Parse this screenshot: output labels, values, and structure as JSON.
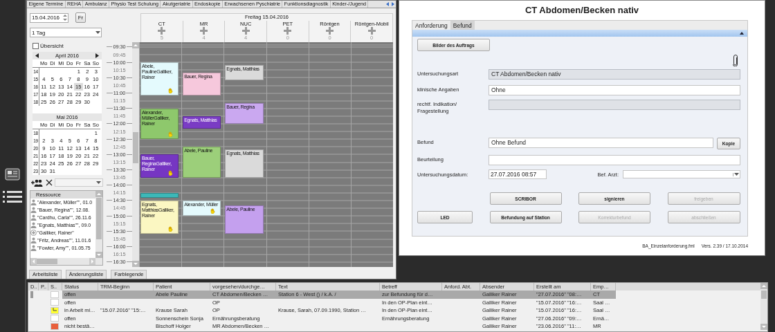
{
  "planner": {
    "tabs": [
      {
        "label": "Eigene Termine",
        "selected": false
      },
      {
        "label": "REHA",
        "selected": false
      },
      {
        "label": "Ambulanz",
        "selected": false
      },
      {
        "label": "Physio Test Schulung",
        "selected": false
      },
      {
        "label": "Akutgeriatrie",
        "selected": false
      },
      {
        "label": "Endoskopie",
        "selected": false
      },
      {
        "label": "Erwachsenen Pyschiatrie",
        "selected": false
      },
      {
        "label": "Funktionsdiagnostik",
        "selected": false
      },
      {
        "label": "Kinder-/Jugend",
        "selected": false
      }
    ],
    "date_field": {
      "value": "15.04.2016"
    },
    "day_button": "Fr",
    "range_dropdown": {
      "value": "1 Tag"
    },
    "overview_checkbox": {
      "label": "Übersicht",
      "checked": false
    },
    "calendars": [
      {
        "title": "April 2016",
        "nav": true,
        "weekdays": [
          "Mo",
          "Di",
          "Mi",
          "Do",
          "Fr",
          "Sa",
          "So"
        ],
        "weeks": [
          {
            "number": "14",
            "days": [
              {
                "label": "1",
                "selected": false
              },
              {
                "label": "2",
                "selected": false
              },
              {
                "label": "3",
                "selected": false
              }
            ]
          },
          {
            "number": "15",
            "days": [
              {
                "label": "4",
                "selected": false
              },
              {
                "label": "5",
                "selected": false
              },
              {
                "label": "6",
                "selected": false
              },
              {
                "label": "7",
                "selected": false
              },
              {
                "label": "8",
                "selected": false
              },
              {
                "label": "9",
                "selected": false
              },
              {
                "label": "10",
                "selected": false
              }
            ]
          },
          {
            "number": "16",
            "days": [
              {
                "label": "11",
                "selected": false
              },
              {
                "label": "12",
                "selected": false
              },
              {
                "label": "13",
                "selected": false
              },
              {
                "label": "14",
                "selected": false
              },
              {
                "label": "15",
                "selected": true
              },
              {
                "label": "16",
                "selected": false
              },
              {
                "label": "17",
                "selected": false
              }
            ]
          },
          {
            "number": "17",
            "days": [
              {
                "label": "18",
                "selected": false
              },
              {
                "label": "19",
                "selected": false
              },
              {
                "label": "20",
                "selected": false
              },
              {
                "label": "21",
                "selected": false
              },
              {
                "label": "22",
                "selected": false
              },
              {
                "label": "23",
                "selected": false
              },
              {
                "label": "24",
                "selected": false
              }
            ]
          },
          {
            "number": "18",
            "days": [
              {
                "label": "25",
                "selected": false
              },
              {
                "label": "26",
                "selected": false
              },
              {
                "label": "27",
                "selected": false
              },
              {
                "label": "28",
                "selected": false
              },
              {
                "label": "29",
                "selected": false
              },
              {
                "label": "30",
                "selected": false
              }
            ]
          }
        ]
      },
      {
        "title": "Mai 2016",
        "nav": false,
        "weekdays": [
          "Mo",
          "Di",
          "Mi",
          "Do",
          "Fr",
          "Sa",
          "So"
        ],
        "weeks": [
          {
            "number": "18",
            "days": [
              {
                "label": "1",
                "selected": false
              }
            ]
          },
          {
            "number": "19",
            "days": [
              {
                "label": "2",
                "selected": false
              },
              {
                "label": "3",
                "selected": false
              },
              {
                "label": "4",
                "selected": false
              },
              {
                "label": "5",
                "selected": false
              },
              {
                "label": "6",
                "selected": false
              },
              {
                "label": "7",
                "selected": false
              },
              {
                "label": "8",
                "selected": false
              }
            ]
          },
          {
            "number": "20",
            "days": [
              {
                "label": "9",
                "selected": false
              },
              {
                "label": "10",
                "selected": false
              },
              {
                "label": "11",
                "selected": false
              },
              {
                "label": "12",
                "selected": false
              },
              {
                "label": "13",
                "selected": false
              },
              {
                "label": "14",
                "selected": false
              },
              {
                "label": "15",
                "selected": false
              }
            ]
          },
          {
            "number": "21",
            "days": [
              {
                "label": "16",
                "selected": false
              },
              {
                "label": "17",
                "selected": false
              },
              {
                "label": "18",
                "selected": false
              },
              {
                "label": "19",
                "selected": false
              },
              {
                "label": "20",
                "selected": false
              },
              {
                "label": "21",
                "selected": false
              },
              {
                "label": "22",
                "selected": false
              }
            ]
          },
          {
            "number": "22",
            "days": [
              {
                "label": "23",
                "selected": false
              },
              {
                "label": "24",
                "selected": false
              },
              {
                "label": "25",
                "selected": false
              },
              {
                "label": "26",
                "selected": false
              },
              {
                "label": "27",
                "selected": false
              },
              {
                "label": "28",
                "selected": false
              },
              {
                "label": "29",
                "selected": false
              }
            ]
          },
          {
            "number": "23",
            "days": [
              {
                "label": "30",
                "selected": false
              },
              {
                "label": "31",
                "selected": false
              }
            ]
          }
        ]
      }
    ],
    "resources": {
      "header": "Ressource",
      "items": [
        {
          "label": "\"Alexander, Müller\"\", 01.0",
          "kind": "person"
        },
        {
          "label": "\"Bauer, Regina\"\", 12.08.",
          "kind": "person"
        },
        {
          "label": "\"Cardhu, Carla\"\", 26.11.6",
          "kind": "person"
        },
        {
          "label": "\"Egnats, Matthias\"\", 09.0",
          "kind": "person"
        },
        {
          "label": "\"Galliker, Rainer\"",
          "kind": "doctor"
        },
        {
          "label": "\"Fritz, Andreas\"\", 11.01.6",
          "kind": "person"
        },
        {
          "label": "\"Fowler, Amy\"\", 01.05.75",
          "kind": "person"
        }
      ]
    },
    "bottom_tabs": [
      {
        "label": "Arbeitsliste",
        "selected": false
      },
      {
        "label": "Änderungsliste",
        "selected": false
      },
      {
        "label": "Farblegende",
        "selected": false
      }
    ],
    "schedule": {
      "date_title": "Freitag 15.04.2016",
      "times": [
        {
          "label": "09:30",
          "major": true
        },
        {
          "label": "09:45",
          "major": false
        },
        {
          "label": "10:00",
          "major": true
        },
        {
          "label": "10:15",
          "major": false
        },
        {
          "label": "10:30",
          "major": true
        },
        {
          "label": "10:45",
          "major": false
        },
        {
          "label": "11:00",
          "major": true
        },
        {
          "label": "11:15",
          "major": false
        },
        {
          "label": "11:30",
          "major": true
        },
        {
          "label": "11:45",
          "major": false
        },
        {
          "label": "12:00",
          "major": true
        },
        {
          "label": "12:15",
          "major": false
        },
        {
          "label": "12:30",
          "major": true
        },
        {
          "label": "12:45",
          "major": false
        },
        {
          "label": "13:00",
          "major": true
        },
        {
          "label": "13:15",
          "major": false
        },
        {
          "label": "13:30",
          "major": true
        },
        {
          "label": "13:45",
          "major": false
        },
        {
          "label": "14:00",
          "major": true
        },
        {
          "label": "14:15",
          "major": false
        },
        {
          "label": "14:30",
          "major": true
        },
        {
          "label": "14:45",
          "major": false
        },
        {
          "label": "15:00",
          "major": true
        },
        {
          "label": "15:15",
          "major": false
        },
        {
          "label": "15:30",
          "major": true
        },
        {
          "label": "15:45",
          "major": false
        },
        {
          "label": "16:00",
          "major": true
        },
        {
          "label": "16:15",
          "major": false
        },
        {
          "label": "16:30",
          "major": true
        }
      ],
      "columns": [
        {
          "name": "CT",
          "count": "5",
          "appointments": [
            {
              "text": "Abele, PaulineGalliker, Rainer",
              "color": "#e4fafd",
              "hand": true
            },
            {
              "text": "Alexander, MüllerGalliker, Rainer",
              "color": "#8ec86c",
              "hand": true
            },
            {
              "text": "Bauer, ReginaGalliker, Rainer",
              "color": "#7636c2",
              "hand": true
            },
            {
              "color": "#3cb8b8",
              "hand": false
            },
            {
              "text": "Egnats, MatthiasGalliker, Rainer",
              "color": "#fbf7c2",
              "hand": true
            }
          ]
        },
        {
          "name": "MR",
          "count": "4",
          "appointments": [
            {
              "text": "Bauer, Regina",
              "color": "#f6c8dc",
              "hand": false
            },
            {
              "text": "Egnats, Matthias",
              "color": "#7a3cc4",
              "hand": false
            },
            {
              "text": "Abele, Pauline",
              "color": "#9ccf7a",
              "hand": false
            },
            {
              "text": "Alexander, Müller",
              "color": "#e4fafd",
              "hand": true
            }
          ]
        },
        {
          "name": "NUC",
          "count": "4",
          "appointments": [
            {
              "text": "Egnats, Matthias",
              "color": "#dadada",
              "hand": false
            },
            {
              "text": "Bauer, Regina",
              "color": "#caa8f0",
              "hand": false
            },
            {
              "text": "Egnats, Matthias",
              "color": "#dadada",
              "hand": false
            },
            {
              "text": "Abele, Pauline",
              "color": "#c4a0ee",
              "hand": false
            }
          ]
        },
        {
          "name": "PET",
          "count": "0"
        },
        {
          "name": "Röntgen",
          "count": "0"
        },
        {
          "name": "Röntgen-Mobil",
          "count": "0"
        }
      ]
    }
  },
  "form": {
    "title": "CT Abdomen/Becken nativ",
    "tabs": [
      {
        "label": "Anforderung",
        "selected": false
      },
      {
        "label": "Befund",
        "selected": true
      }
    ],
    "images_button": "Bilder des Auftrags",
    "fields": [
      {
        "label": "Untersuchungsart",
        "value": "CT Abdomen/Becken nativ",
        "readonly": true
      },
      {
        "label": "klinische Angaben",
        "value": "Ohne",
        "readonly": false
      },
      {
        "label": "rechtf. Indikation/\nFragestellung",
        "readonly": true
      },
      {
        "label": "Befund",
        "value": "Ohne Befund",
        "readonly": false,
        "button": "Kopie"
      },
      {
        "label": "Beurteilung",
        "readonly": false
      }
    ],
    "date": {
      "label": "Untersuchungsdatum:",
      "value": "27.07.2016 08:57"
    },
    "doctor": {
      "label": "Bef. Arzt:"
    },
    "button_rows": [
      [
        {
          "label": "SCRIBOR",
          "disabled": false
        },
        {
          "label": "signieren",
          "disabled": false
        },
        {
          "label": "freigeben",
          "disabled": true
        }
      ],
      [
        {
          "label": "LED",
          "disabled": false
        },
        {
          "label": "Befundung auf Station",
          "disabled": false
        },
        {
          "label": "Korrekturbefund",
          "disabled": true
        },
        {
          "label": "abschließen",
          "disabled": true
        }
      ]
    ],
    "footer": {
      "file": "BA_Einzelanforderung.fml",
      "version": "Vers. 2.39 / 17.10.2014"
    }
  },
  "table": {
    "columns": [
      "D..",
      "P..",
      "S..",
      "Status",
      "TRM-Beginn",
      "Patient",
      "vorgesehen/durchge…",
      "Text",
      "Betreff",
      "Anford. Abt.",
      "Absender",
      "Erstellt am",
      "Emp…"
    ],
    "rows": [
      {
        "selected": true,
        "color": "#ffffff",
        "marked": false,
        "status": "offen",
        "patient": "Abele Pauline",
        "planned": "CT Abdomen/Becken …",
        "text": "Station 6 - West () / k.A. /",
        "subject": "zur Befundung für d…",
        "sender": "Galliker Rainer",
        "created": "\"27.07.2016\" \"08:…",
        "recipient": "CT"
      },
      {
        "selected": false,
        "color": "#ffffff",
        "marked": false,
        "status": "offen",
        "planned": "OP",
        "subject": "In den OP-Plan eint…",
        "sender": "Galliker Rainer",
        "created": "\"15.07.2016\" \"16:…",
        "recipient": "Saal …"
      },
      {
        "selected": false,
        "color": "#ffff33",
        "marked": true,
        "status": "in Arbeit mi…",
        "start": "\"15.07.2016\" \"15:…",
        "patient": "Krause Sarah",
        "planned": "OP",
        "text": "Krause, Sarah, 07.09.1990, Station …",
        "subject": "In den OP-Plan eint…",
        "sender": "Galliker Rainer",
        "created": "\"15.07.2016\" \"16:…",
        "recipient": "Saal …"
      },
      {
        "selected": false,
        "color": "#ffffff",
        "marked": false,
        "status": "offen",
        "patient": "Sonnenschein Sonja",
        "planned": "Ernährungsberatung",
        "subject": "Ernährungsberatung",
        "sender": "Galliker Rainer",
        "created": "\"27.06.2016\" \"09:…",
        "recipient": "Ernä…"
      },
      {
        "selected": false,
        "color": "#e8603c",
        "marked": false,
        "status": "nicht bestä…",
        "patient": "Bischoff Holger",
        "planned": "MR Abdomen/Becken …",
        "sender": "Galliker Rainer",
        "created": "\"23.06.2016\" \"11:…",
        "recipient": "MR"
      }
    ]
  }
}
